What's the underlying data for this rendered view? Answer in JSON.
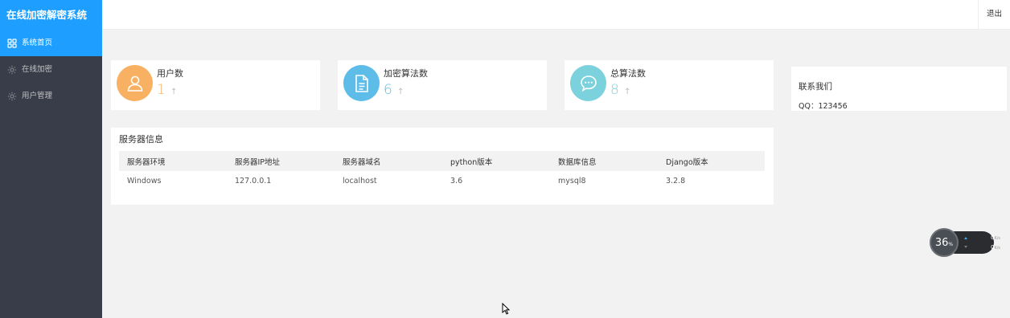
{
  "app": {
    "title": "在线加密解密系统"
  },
  "sidebar": {
    "items": [
      {
        "label": "系统首页",
        "icon": "grid-icon",
        "active": true
      },
      {
        "label": "在线加密",
        "icon": "settings-icon",
        "active": false
      },
      {
        "label": "用户管理",
        "icon": "settings-icon",
        "active": false
      }
    ]
  },
  "header": {
    "logout_label": "退出"
  },
  "stats": [
    {
      "title": "用户数",
      "value": "1",
      "arrow": "↑",
      "color": "#f8b162",
      "icon": "user-icon"
    },
    {
      "title": "加密算法数",
      "value": "6",
      "arrow": "↑",
      "color": "#5dbde8",
      "icon": "document-icon"
    },
    {
      "title": "总算法数",
      "value": "8",
      "arrow": "↑",
      "color": "#7bd1dc",
      "icon": "chat-icon"
    }
  ],
  "contact": {
    "title": "联系我们",
    "qq": "QQ：123456"
  },
  "server": {
    "title": "服务器信息",
    "columns": [
      "服务器环境",
      "服务器IP地址",
      "服务器域名",
      "python版本",
      "数据库信息",
      "Django版本"
    ],
    "rows": [
      [
        "Windows",
        "127.0.0.1",
        "localhost",
        "3.6",
        "mysql8",
        "3.2.8"
      ]
    ]
  },
  "widget": {
    "percent": "36",
    "percent_unit": "%",
    "up_speed": "0",
    "down_speed": "0",
    "speed_unit": "K/s"
  }
}
